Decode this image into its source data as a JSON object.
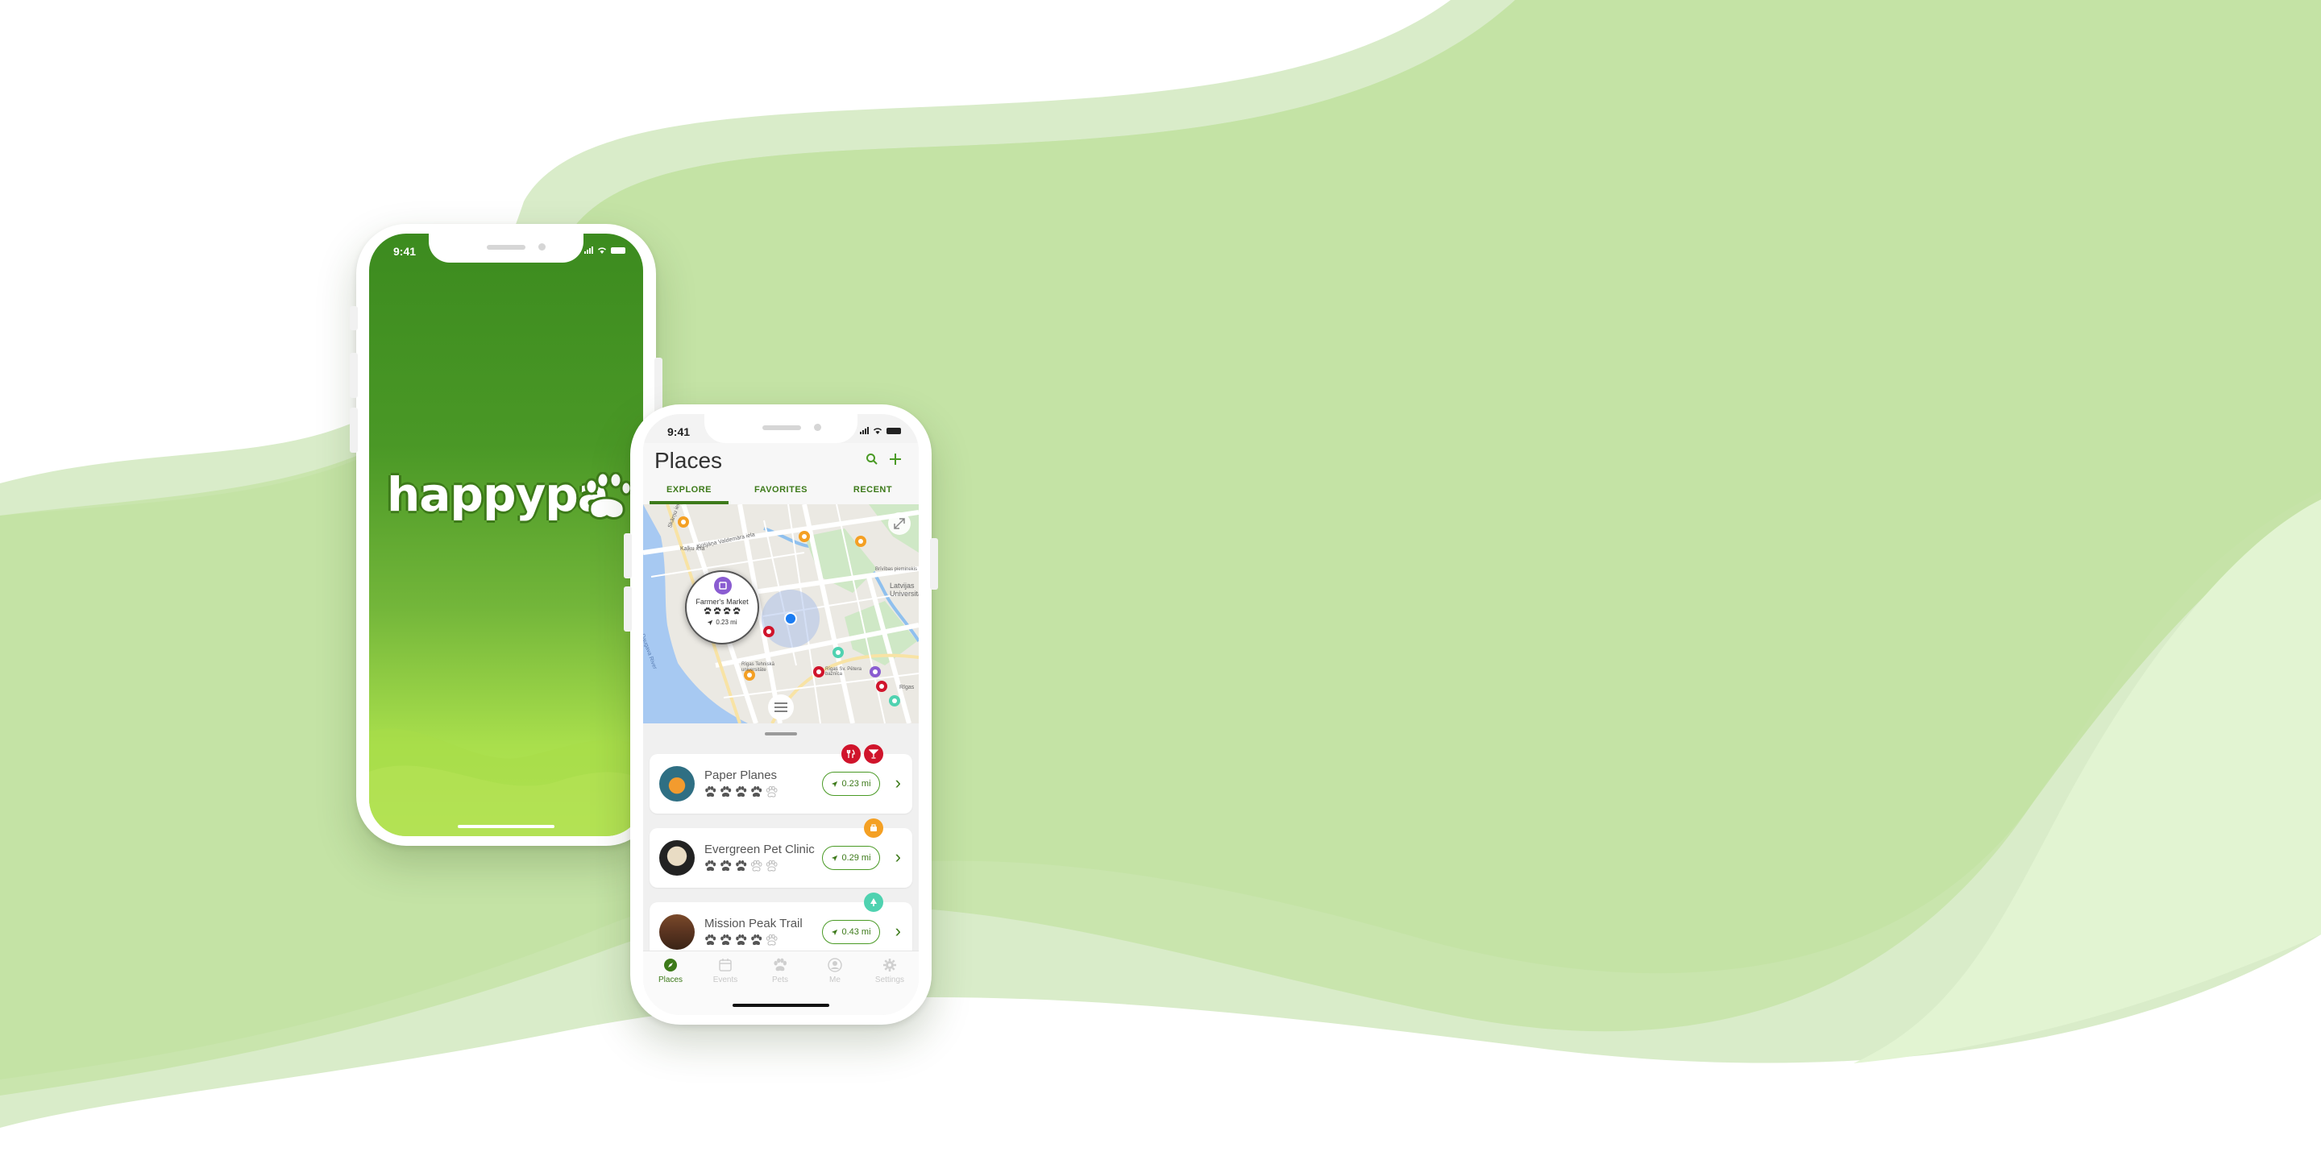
{
  "colors": {
    "brand_green": "#3d7a1a",
    "accent_green": "#4a9a25",
    "wave_light": "#d9ecc9",
    "wave_mid": "#c7e4a9",
    "restaurant": "#d0142b",
    "vet": "#f4a024",
    "trail": "#4fd2b0"
  },
  "splash": {
    "status_time": "9:41",
    "logo_text": "happypa"
  },
  "places_screen": {
    "status_time": "9:41",
    "title": "Places",
    "icons": {
      "search": "search-icon",
      "add": "plus-icon"
    },
    "tabs": [
      {
        "label": "EXPLORE",
        "active": true
      },
      {
        "label": "FAVORITES",
        "active": false
      },
      {
        "label": "RECENT",
        "active": false
      }
    ],
    "map": {
      "streets": [
        "Skārņu iela",
        "Kaļķu iela",
        "Krišjāņa Valdemāra iela",
        "Daugava River",
        "Rīgas Tehniskā universitāte",
        "Rīgas Sv. Pētera baznīca",
        "Latvijas Universitāte",
        "Brīvības pieminekis",
        "Rīgas"
      ],
      "popup": {
        "name": "Farmer's Market",
        "rating": 4,
        "rating_max": 4,
        "distance": "0.23 mi"
      }
    },
    "places": [
      {
        "name": "Paper Planes",
        "rating": 4,
        "rating_max": 5,
        "distance": "0.23 mi",
        "badges": [
          "restaurant-icon",
          "bar-icon"
        ]
      },
      {
        "name": "Evergreen Pet Clinic",
        "rating": 3,
        "rating_max": 5,
        "distance": "0.29 mi",
        "badges": [
          "vet-icon"
        ]
      },
      {
        "name": "Mission Peak Trail",
        "rating": 4,
        "rating_max": 5,
        "distance": "0.43 mi",
        "badges": [
          "trail-icon"
        ]
      }
    ],
    "tabbar": [
      {
        "label": "Places",
        "icon": "compass-icon",
        "active": true
      },
      {
        "label": "Events",
        "icon": "calendar-icon",
        "active": false
      },
      {
        "label": "Pets",
        "icon": "paw-icon",
        "active": false
      },
      {
        "label": "Me",
        "icon": "profile-icon",
        "active": false
      },
      {
        "label": "Settings",
        "icon": "gear-icon",
        "active": false
      }
    ]
  }
}
